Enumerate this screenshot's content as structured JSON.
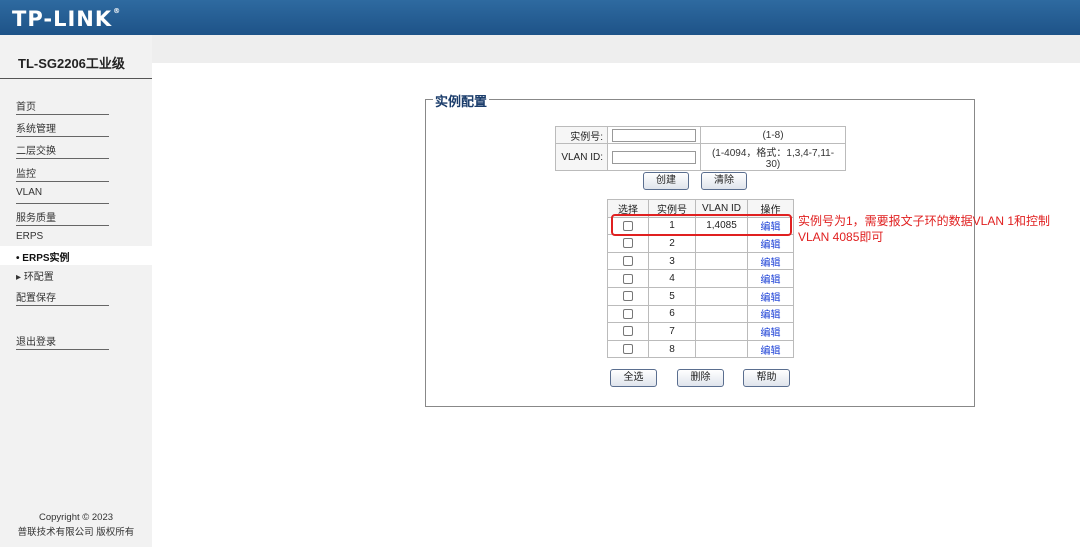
{
  "header": {
    "logo": "TP-LINK",
    "logo_mark": "®"
  },
  "sidebar": {
    "model": "TL-SG2206工业级",
    "items": [
      {
        "label": "首页"
      },
      {
        "label": "系统管理"
      },
      {
        "label": "二层交换"
      },
      {
        "label": "监控"
      },
      {
        "label": "VLAN"
      },
      {
        "label": "服务质量"
      },
      {
        "label": "ERPS"
      },
      {
        "label": "ERPS实例",
        "active": true
      },
      {
        "label": "环配置"
      },
      {
        "label": "配置保存"
      },
      {
        "label": "退出登录"
      }
    ],
    "active_marker": "•",
    "collapsed_marker": "▸",
    "copyright_line1": "Copyright © 2023",
    "copyright_line2": "普联技术有限公司 版权所有"
  },
  "main": {
    "section_title": "实例配置",
    "form": {
      "instance_label": "实例号:",
      "instance_value": "",
      "instance_hint": "(1-8)",
      "vlan_label": "VLAN ID:",
      "vlan_value": "",
      "vlan_hint": "(1-4094，格式：1,3,4-7,11-30)"
    },
    "buttons": {
      "create": "创建",
      "clear": "清除",
      "select_all": "全选",
      "delete": "删除",
      "help": "帮助"
    },
    "table": {
      "headers": [
        "选择",
        "实例号",
        "VLAN ID",
        "操作"
      ],
      "rows": [
        {
          "checked": false,
          "instance": "1",
          "vlan": "1,4085",
          "action": "编辑"
        },
        {
          "checked": false,
          "instance": "2",
          "vlan": "",
          "action": "编辑"
        },
        {
          "checked": false,
          "instance": "3",
          "vlan": "",
          "action": "编辑"
        },
        {
          "checked": false,
          "instance": "4",
          "vlan": "",
          "action": "编辑"
        },
        {
          "checked": false,
          "instance": "5",
          "vlan": "",
          "action": "编辑"
        },
        {
          "checked": false,
          "instance": "6",
          "vlan": "",
          "action": "编辑"
        },
        {
          "checked": false,
          "instance": "7",
          "vlan": "",
          "action": "编辑"
        },
        {
          "checked": false,
          "instance": "8",
          "vlan": "",
          "action": "编辑"
        }
      ]
    }
  },
  "annotation": {
    "text": "实例号为1，需要报文子环的数据VLAN 1和控制VLAN 4085即可",
    "color": "#e02020"
  },
  "colors": {
    "header_bg": "#1e5388",
    "link": "#1a3fd6",
    "title": "#1b3d6b"
  }
}
